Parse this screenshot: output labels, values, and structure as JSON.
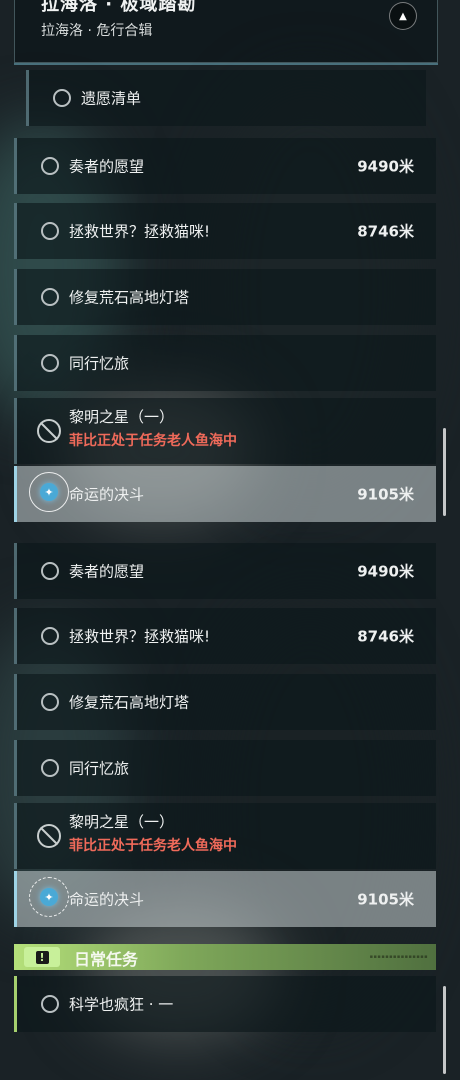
{
  "top_panel": {
    "header": {
      "title": "拉海洛 · 极域踏勘",
      "subtitle": "拉海洛 · 危行合辑"
    },
    "quests": [
      {
        "label": "遗愿清单",
        "distance": "",
        "status": ""
      },
      {
        "label": "奏者的愿望",
        "distance": "9490米",
        "status": ""
      },
      {
        "label": "拯救世界？拯救猫咪!",
        "distance": "8746米",
        "status": ""
      },
      {
        "label": "修复荒石高地灯塔",
        "distance": "",
        "status": ""
      },
      {
        "label": "同行忆旅",
        "distance": "",
        "status": ""
      },
      {
        "label": "黎明之星（一）",
        "distance": "",
        "status": "菲比正处于任务老人鱼海中"
      },
      {
        "label": "命运的决斗",
        "distance": "9105米",
        "status": ""
      }
    ]
  },
  "bottom_panel": {
    "quests": [
      {
        "label": "奏者的愿望",
        "distance": "9490米",
        "status": ""
      },
      {
        "label": "拯救世界？拯救猫咪!",
        "distance": "8746米",
        "status": ""
      },
      {
        "label": "修复荒石高地灯塔",
        "distance": "",
        "status": ""
      },
      {
        "label": "同行忆旅",
        "distance": "",
        "status": ""
      },
      {
        "label": "黎明之星（一）",
        "distance": "",
        "status": "菲比正处于任务老人鱼海中"
      },
      {
        "label": "命运的决斗",
        "distance": "9105米",
        "status": ""
      }
    ],
    "daily_section": {
      "title": "日常任务",
      "icon": "exclamation-icon",
      "quests": [
        {
          "label": "科学也疯狂 · 一"
        }
      ]
    }
  },
  "colors": {
    "warning_text": "#ef6a5a",
    "active_row": "#c8d2d4",
    "daily_accent": "#a6d06e",
    "nav_icon": "#4aa9d6"
  }
}
